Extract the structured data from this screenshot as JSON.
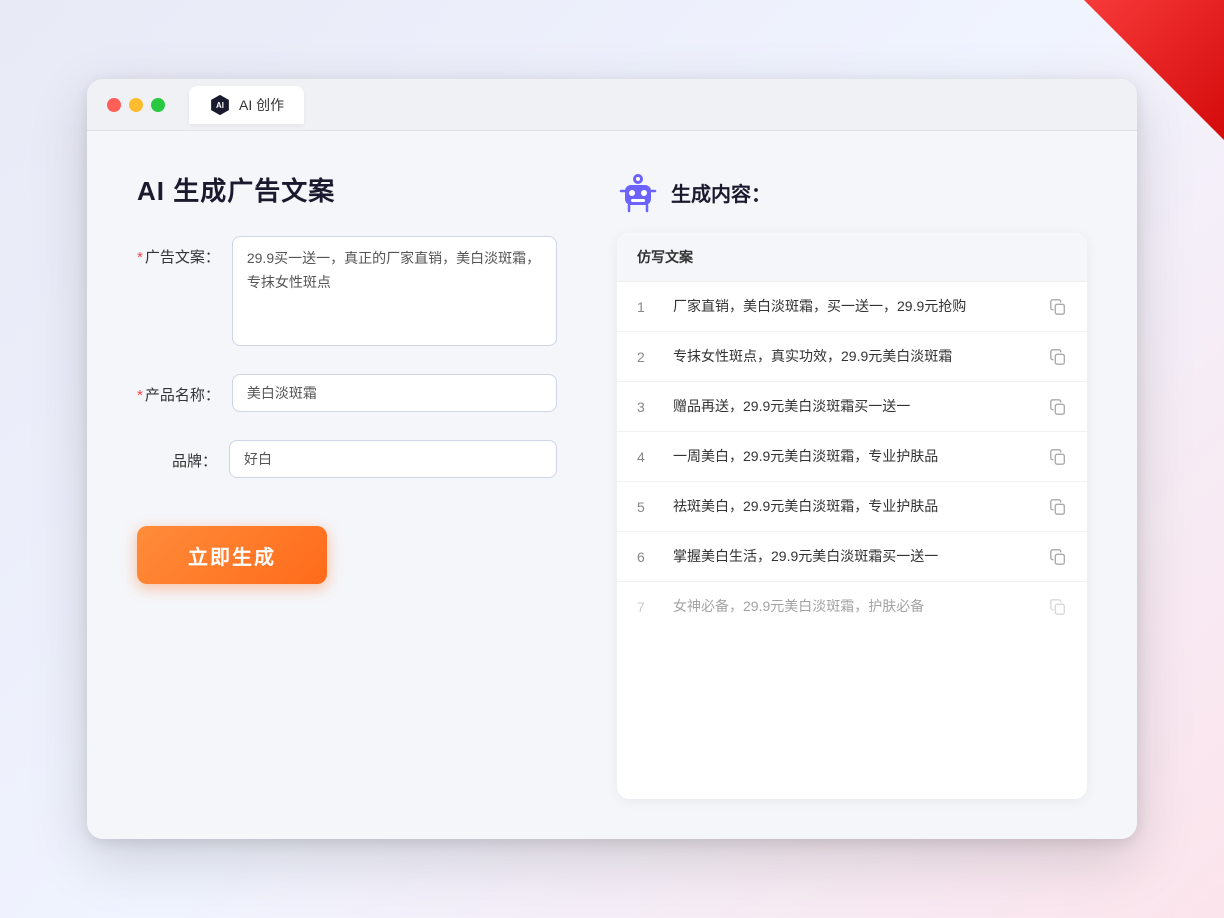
{
  "browser": {
    "tab_label": "AI 创作",
    "traffic_lights": [
      "red",
      "yellow",
      "green"
    ]
  },
  "left_panel": {
    "page_title": "AI 生成广告文案",
    "form": {
      "ad_copy_label": "广告文案：",
      "ad_copy_required": "*",
      "ad_copy_value": "29.9买一送一，真正的厂家直销，美白淡斑霜，专抹女性斑点",
      "product_name_label": "产品名称：",
      "product_name_required": "*",
      "product_name_value": "美白淡斑霜",
      "brand_label": "品牌：",
      "brand_value": "好白"
    },
    "generate_button": "立即生成"
  },
  "right_panel": {
    "result_title": "生成内容：",
    "table_header": "仿写文案",
    "items": [
      {
        "num": "1",
        "text": "厂家直销，美白淡斑霜，买一送一，29.9元抢购"
      },
      {
        "num": "2",
        "text": "专抹女性斑点，真实功效，29.9元美白淡斑霜"
      },
      {
        "num": "3",
        "text": "赠品再送，29.9元美白淡斑霜买一送一"
      },
      {
        "num": "4",
        "text": "一周美白，29.9元美白淡斑霜，专业护肤品"
      },
      {
        "num": "5",
        "text": "祛斑美白，29.9元美白淡斑霜，专业护肤品"
      },
      {
        "num": "6",
        "text": "掌握美白生活，29.9元美白淡斑霜买一送一"
      },
      {
        "num": "7",
        "text": "女神必备，29.9元美白淡斑霜，护肤必备",
        "faded": true
      }
    ]
  }
}
